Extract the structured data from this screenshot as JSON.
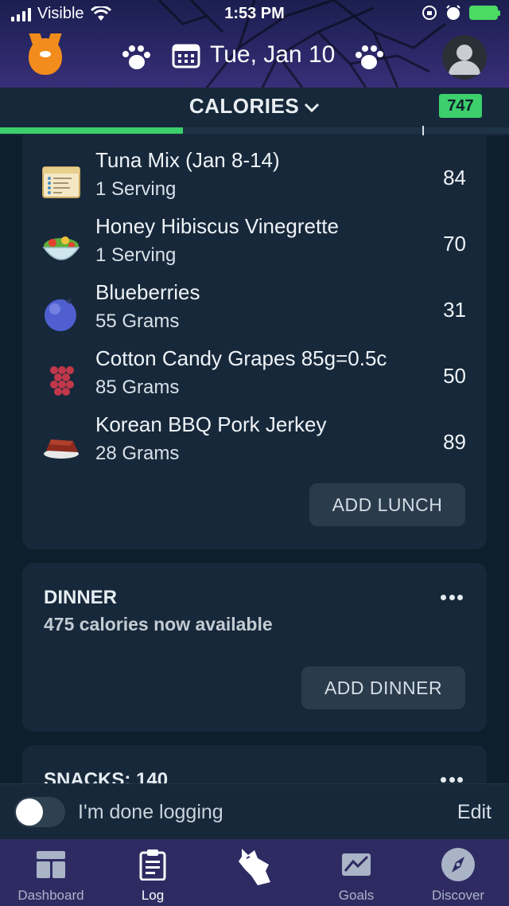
{
  "status_bar": {
    "carrier": "Visible",
    "time": "1:53 PM"
  },
  "header": {
    "date": "Tue, Jan 10",
    "icons": [
      "lose-it-logo-icon",
      "paw-left-icon",
      "calendar-icon",
      "paw-right-icon",
      "profile-avatar-icon"
    ]
  },
  "tabs": {
    "title": "CALORIES",
    "budget_badge": "747",
    "progress_fraction": 0.36
  },
  "lunch": {
    "items": [
      {
        "name": "Tuna Mix (Jan 8-14)",
        "serving": "1 Serving",
        "calories": "84",
        "icon": "recipe-card-icon"
      },
      {
        "name": "Honey Hibiscus Vinegrette",
        "serving": "1 Serving",
        "calories": "70",
        "icon": "salad-bowl-icon"
      },
      {
        "name": "Blueberries",
        "serving": "55 Grams",
        "calories": "31",
        "icon": "blueberry-icon"
      },
      {
        "name": "Cotton Candy Grapes 85g=0.5c",
        "serving": "85 Grams",
        "calories": "50",
        "icon": "grapes-icon"
      },
      {
        "name": "Korean BBQ Pork Jerkey",
        "serving": "28 Grams",
        "calories": "89",
        "icon": "jerky-icon"
      }
    ],
    "add_label": "ADD LUNCH"
  },
  "dinner": {
    "title": "DINNER",
    "subtitle": "475 calories now available",
    "add_label": "ADD DINNER"
  },
  "snacks": {
    "title": "SNACKS: 140"
  },
  "done_bar": {
    "label": "I'm done logging",
    "edit": "Edit",
    "toggle_on": false
  },
  "bottom_nav": {
    "items": [
      {
        "label": "Dashboard",
        "icon": "dashboard-icon"
      },
      {
        "label": "Log",
        "icon": "log-clipboard-icon",
        "active": true
      },
      {
        "label": "",
        "icon": "howl-wolf-icon"
      },
      {
        "label": "Goals",
        "icon": "goals-chart-icon"
      },
      {
        "label": "Discover",
        "icon": "compass-icon"
      }
    ]
  },
  "colors": {
    "accent_green": "#3ccf6c",
    "header_purple": "#2a2766",
    "background": "#0f1e2c",
    "card": "#17283a"
  }
}
